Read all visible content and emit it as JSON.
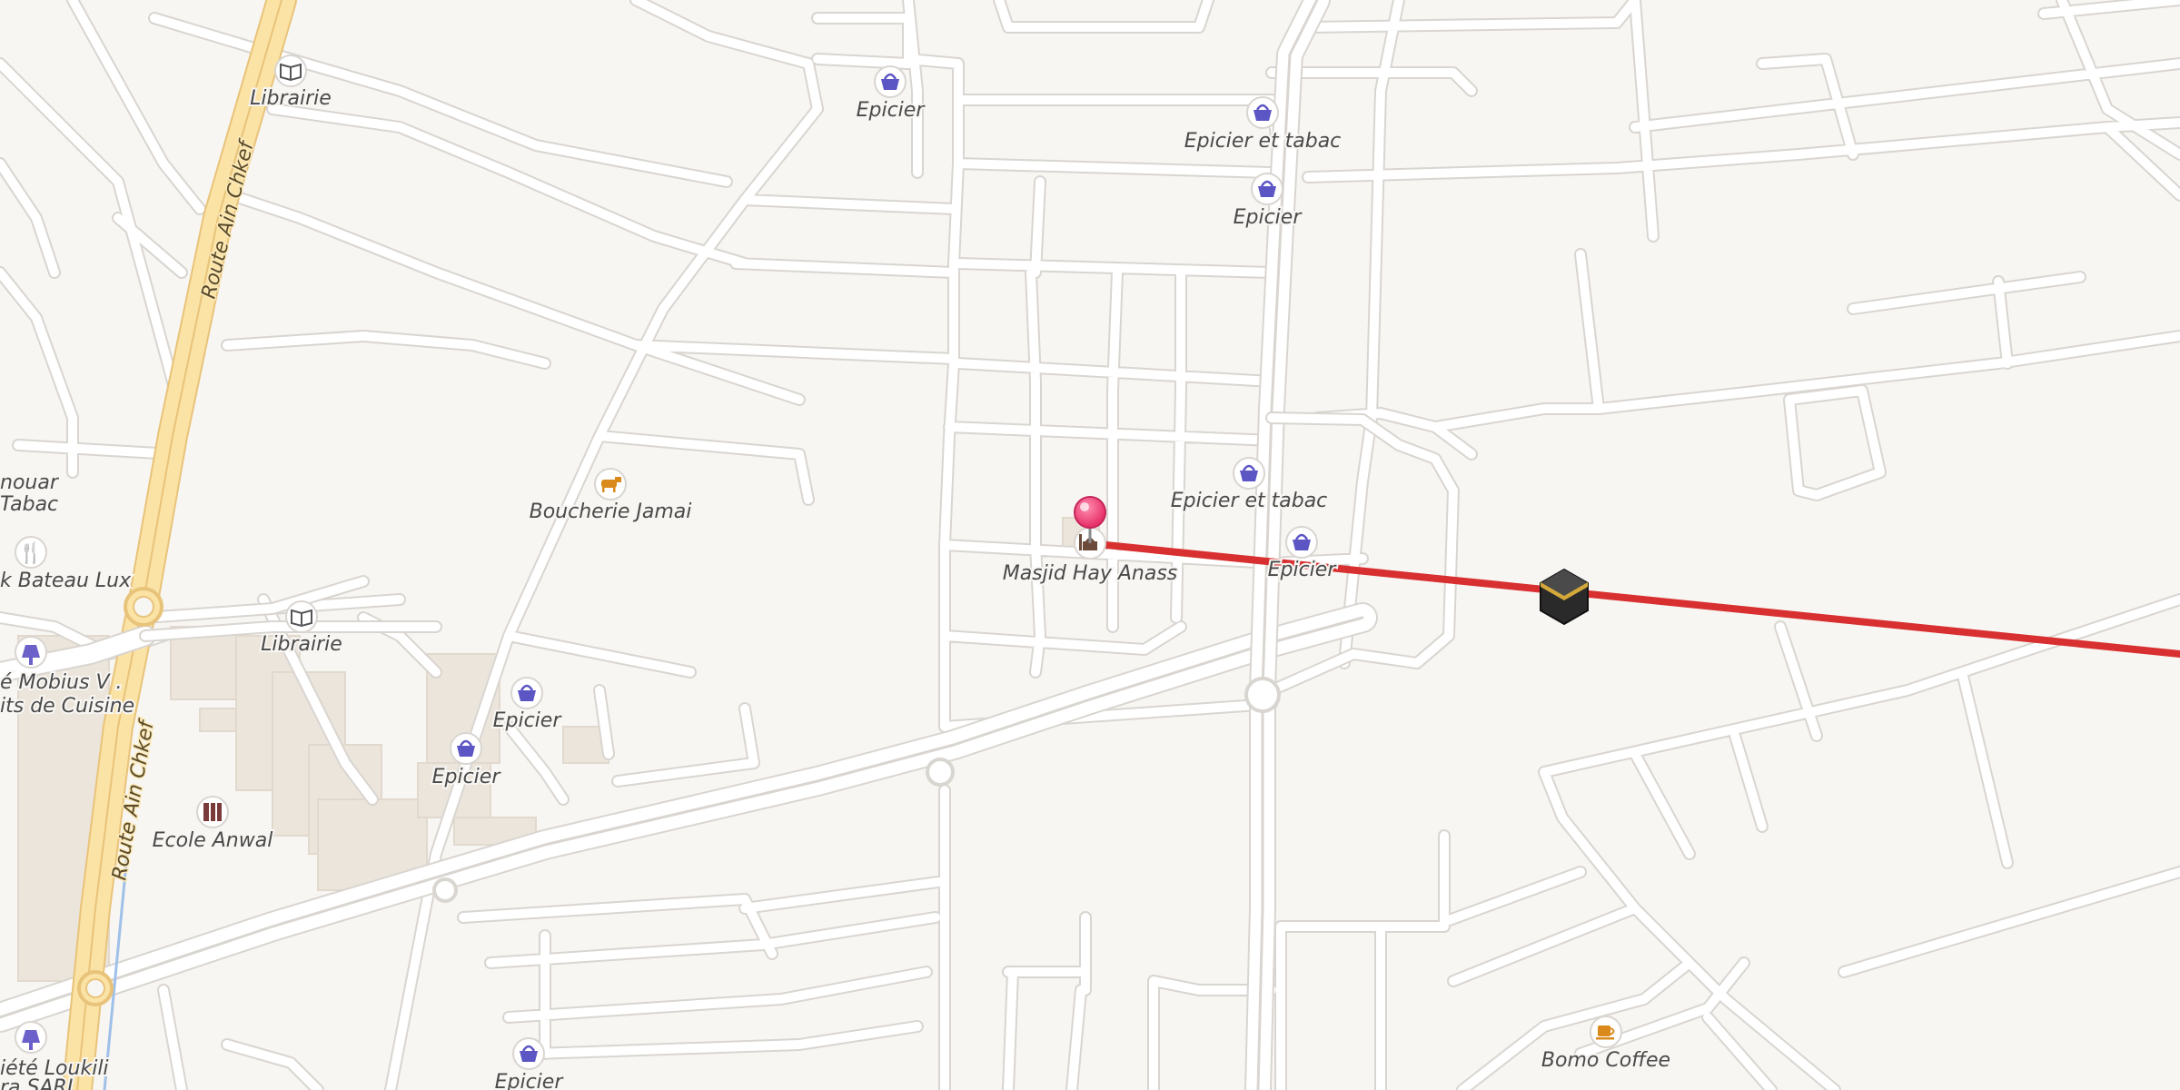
{
  "map": {
    "road_labels": [
      "Route Ain Chkef",
      "Route Ain Chkef"
    ],
    "pois": [
      {
        "label": "Librairie",
        "icon": "book-icon"
      },
      {
        "label": "Epicier",
        "icon": "basket-icon"
      },
      {
        "label": "Epicier et tabac",
        "icon": "basket-icon"
      },
      {
        "label": "Epicier",
        "icon": "basket-icon"
      },
      {
        "label": "Boucherie Jamai",
        "icon": "cow-icon"
      },
      {
        "label": "Epicier et tabac",
        "icon": "basket-icon"
      },
      {
        "label": "Epicier",
        "icon": "basket-icon"
      },
      {
        "label": "Masjid Hay Anass",
        "icon": "mosque-icon"
      },
      {
        "label": "Librairie",
        "icon": "book-icon"
      },
      {
        "label": "Epicier",
        "icon": "basket-icon"
      },
      {
        "label": "Epicier",
        "icon": "basket-icon"
      },
      {
        "label": "Ecole Anwal",
        "icon": "school-icon"
      },
      {
        "label": "Epicier",
        "icon": "basket-icon"
      },
      {
        "label": "Bomo Coffee",
        "icon": "coffee-icon"
      }
    ],
    "edge_labels": [
      "nouar",
      "Tabac",
      "k Bateau Lux",
      "é Mobius V .",
      "its de Cuisine",
      "iété Loukili",
      "ra SARL"
    ],
    "pin": {
      "color": "#e8336b",
      "icon": "location-pin-icon"
    },
    "qibla": {
      "color": "#d83030",
      "icon": "kaaba-icon"
    }
  }
}
